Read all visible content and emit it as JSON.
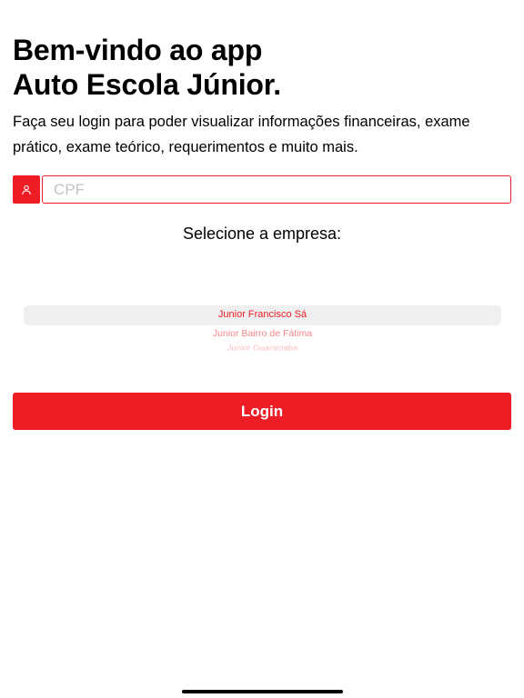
{
  "header": {
    "title_line1": "Bem-vindo ao app",
    "title_line2": "Auto Escola Júnior.",
    "subtitle": "Faça seu login para poder visualizar informações financeiras, exame prático, exame teórico, requerimentos e muito mais."
  },
  "login_form": {
    "cpf_icon": "user-icon",
    "cpf_placeholder": "CPF",
    "cpf_value": "",
    "company_label": "Selecione a empresa:",
    "company_options": [
      "Junior Francisco Sá",
      "Junior Bairro de Fátima",
      "Junior Guaraciaba",
      ""
    ],
    "selected_company": "Junior Francisco Sá",
    "login_label": "Login"
  },
  "colors": {
    "accent": "#ee1c25",
    "picker_highlight": "#efefef",
    "placeholder": "#c4c4c4"
  }
}
